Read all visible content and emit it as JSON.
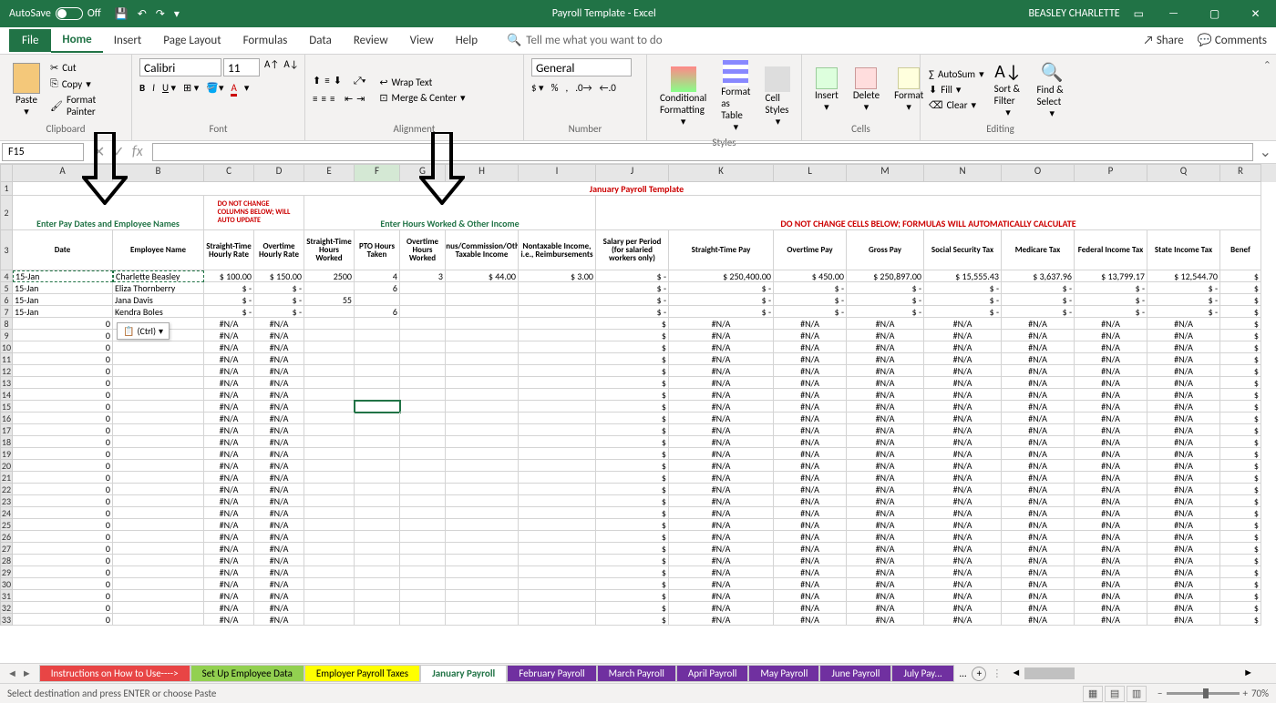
{
  "titlebar": {
    "autosave": "AutoSave",
    "off": "Off",
    "title": "Payroll Template - Excel",
    "user": "BEASLEY CHARLETTE"
  },
  "tabs": {
    "file": "File",
    "home": "Home",
    "insert": "Insert",
    "pagelayout": "Page Layout",
    "formulas": "Formulas",
    "data": "Data",
    "review": "Review",
    "view": "View",
    "help": "Help",
    "tellme": "Tell me what you want to do",
    "share": "Share",
    "comments": "Comments"
  },
  "ribbon": {
    "clipboard": {
      "label": "Clipboard",
      "paste": "Paste",
      "cut": "Cut",
      "copy": "Copy",
      "fp": "Format Painter"
    },
    "font": {
      "label": "Font",
      "name": "Calibri",
      "size": "11"
    },
    "alignment": {
      "label": "Alignment",
      "wrap": "Wrap Text",
      "merge": "Merge & Center"
    },
    "number": {
      "label": "Number",
      "fmt": "General"
    },
    "styles": {
      "label": "Styles",
      "cf": "Conditional Formatting",
      "fat": "Format as Table",
      "cs": "Cell Styles"
    },
    "cells": {
      "label": "Cells",
      "ins": "Insert",
      "del": "Delete",
      "fmt": "Format"
    },
    "editing": {
      "label": "Editing",
      "autosum": "AutoSum",
      "fill": "Fill",
      "clear": "Clear",
      "sf": "Sort & Filter",
      "fs": "Find & Select"
    }
  },
  "namebox": "F15",
  "sheet": {
    "title": "January Payroll Template",
    "h1": "Enter Pay Dates and Employee Names",
    "h2_l1": "DO NOT CHANGE",
    "h2_l2": "COLUMNS BELOW; WILL",
    "h2_l3": "AUTO UPDATE",
    "h3": "Enter Hours Worked & Other Income",
    "h4": "DO NOT CHANGE CELLS BELOW; FORMULAS WILL AUTOMATICALLY CALCULATE",
    "cols": {
      "A": "Date",
      "B": "Employee Name",
      "C": "Straight-Time Hourly Rate",
      "D": "Overtime Hourly Rate",
      "E": "Straight-Time Hours Worked",
      "F": "PTO Hours Taken",
      "G": "Overtime Hours Worked",
      "H": "Bonus/Commission/Other Taxable Income",
      "I": "Nontaxable Income, i.e., Reimbursements",
      "J": "Salary per Period (for salaried workers only)",
      "K": "Straight-Time Pay",
      "L": "Overtime Pay",
      "M": "Gross Pay",
      "N": "Social Security Tax",
      "O": "Medicare Tax",
      "P": "Federal Income Tax",
      "Q": "State Income Tax",
      "R": "Benef"
    },
    "rows": [
      {
        "A": "15-Jan",
        "B": "Charlette Beasley",
        "C": "$    100.00",
        "D": "$    150.00",
        "E": "2500",
        "F": "4",
        "G": "3",
        "H": "$         44.00",
        "I": "$         3.00",
        "J": "$            -",
        "K": "$         250,400.00",
        "L": "$         450.00",
        "M": "$     250,897.00",
        "N": "$     15,555.43",
        "O": "$      3,637.96",
        "P": "$     13,799.17",
        "Q": "$     12,544.70",
        "R": "$"
      },
      {
        "A": "15-Jan",
        "B": "Eliza Thornberry",
        "C": "$          -",
        "D": "$          -",
        "E": "",
        "F": "6",
        "G": "",
        "H": "",
        "I": "",
        "J": "$            -",
        "K": "$                  -",
        "L": "$              -",
        "M": "$               -",
        "N": "$              -",
        "O": "$             -",
        "P": "$             -",
        "Q": "$             -",
        "R": "$"
      },
      {
        "A": "15-Jan",
        "B": "Jana Davis",
        "C": "$          -",
        "D": "$          -",
        "E": "55",
        "F": "",
        "G": "",
        "H": "",
        "I": "",
        "J": "$            -",
        "K": "$                  -",
        "L": "$              -",
        "M": "$               -",
        "N": "$              -",
        "O": "$             -",
        "P": "$             -",
        "Q": "$             -",
        "R": "$"
      },
      {
        "A": "15-Jan",
        "B": "Kendra Boles",
        "C": "$          -",
        "D": "$          -",
        "E": "",
        "F": "6",
        "G": "",
        "H": "",
        "I": "",
        "J": "$            -",
        "K": "$                  -",
        "L": "$              -",
        "M": "$               -",
        "N": "$              -",
        "O": "$             -",
        "P": "$             -",
        "Q": "$             -",
        "R": "$"
      }
    ],
    "na": "#N/A",
    "pasteopt": "(Ctrl)"
  },
  "sheettabs": [
    "Instructions on How to Use---->",
    "Set Up Employee Data",
    "Employer Payroll Taxes",
    "January Payroll",
    "February Payroll",
    "March Payroll",
    "April Payroll",
    "May Payroll",
    "June Payroll",
    "July Pay..."
  ],
  "status": {
    "msg": "Select destination and press ENTER or choose Paste",
    "zoom": "70%"
  },
  "colwidths": {
    "A": 110,
    "B": 100,
    "C": 55,
    "D": 55,
    "E": 55,
    "F": 50,
    "G": 50,
    "H": 80,
    "I": 85,
    "J": 80,
    "K": 115,
    "L": 80,
    "M": 85,
    "N": 85,
    "O": 80,
    "P": 80,
    "Q": 80,
    "R": 45
  }
}
